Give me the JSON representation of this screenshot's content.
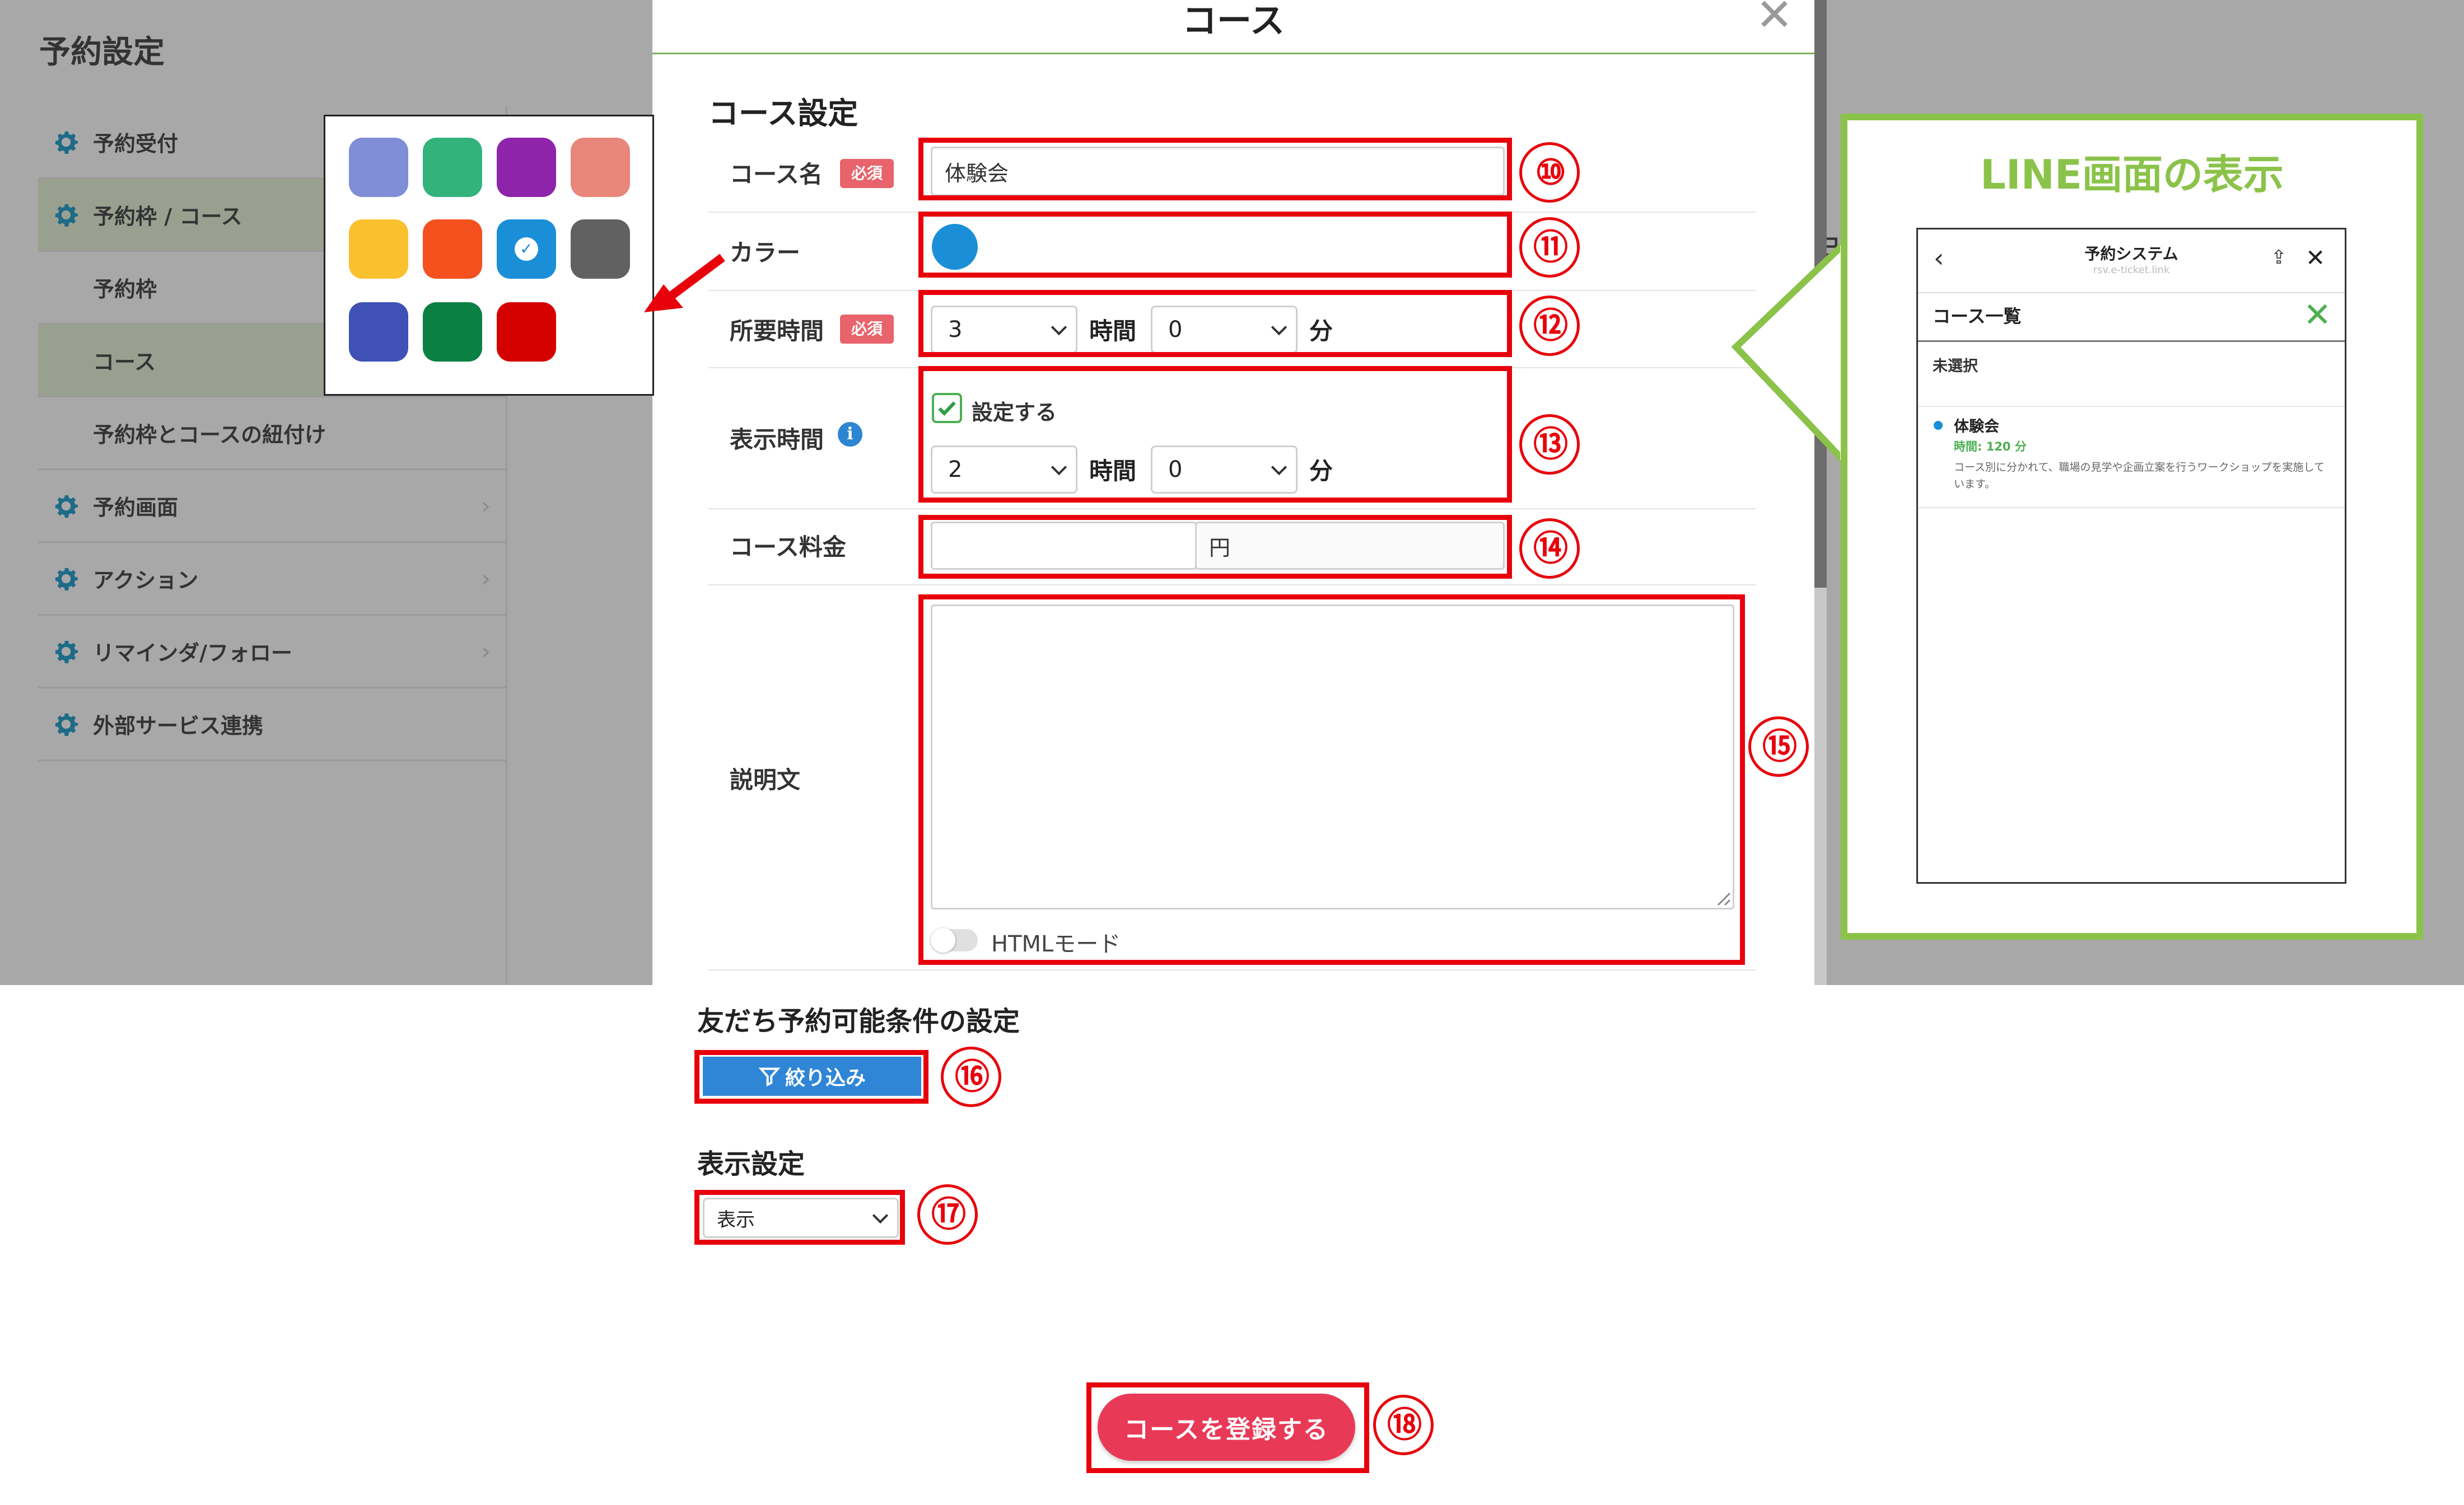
{
  "background_app": {
    "page_title": "予約設定",
    "sidebar": {
      "items": [
        {
          "label": "予約受付",
          "icon": "gear-icon"
        },
        {
          "label": "予約枠 / コース",
          "icon": "gear-icon"
        },
        {
          "label": "予約枠"
        },
        {
          "label": "コース"
        },
        {
          "label": "予約枠とコースの紐付け"
        },
        {
          "label": "予約画面",
          "icon": "gear-icon",
          "chevron": "›"
        },
        {
          "label": "アクション",
          "icon": "gear-icon",
          "chevron": "›"
        },
        {
          "label": "リマインダ/フォロー",
          "icon": "gear-icon",
          "chevron": "›"
        },
        {
          "label": "外部サービス連携",
          "icon": "gear-icon"
        }
      ]
    },
    "right_fragment": "日"
  },
  "modal": {
    "title": "コース",
    "close": "✕",
    "section_title": "コース設定",
    "course_name": {
      "label": "コース名",
      "required": "必須",
      "value": "体験会"
    },
    "color": {
      "label": "カラー",
      "selected": "#1a8fd8"
    },
    "duration": {
      "label": "所要時間",
      "required": "必須",
      "hours": "3",
      "hours_unit": "時間",
      "minutes": "0",
      "minutes_unit": "分"
    },
    "display_time": {
      "label": "表示時間",
      "info": "i",
      "checkbox_label": "設定する",
      "checked": true,
      "hours": "2",
      "hours_unit": "時間",
      "minutes": "0",
      "minutes_unit": "分"
    },
    "fee": {
      "label": "コース料金",
      "value": "",
      "unit": "円"
    },
    "description": {
      "label": "説明文",
      "value": "",
      "html_mode_label": "HTMLモード"
    }
  },
  "palette": {
    "colors": [
      "#7f8ed6",
      "#32b37c",
      "#8e24aa",
      "#e8867c",
      "#fbc02d",
      "#f4511e",
      "#1a8fd8",
      "#616161",
      "#3f51b5",
      "#0b8043",
      "#d50000"
    ],
    "selected_index": 6,
    "check": "✓"
  },
  "line_preview": {
    "title": "LINE画面の表示",
    "app_title": "予約システム",
    "url": "rsv.e-ticket.link",
    "back": "‹",
    "share": "⇪",
    "close": "✕",
    "list_title": "コース一覧",
    "list_close": "✕",
    "unselected": "未選択",
    "course_name": "体験会",
    "course_time": "時間: 120 分",
    "course_desc": "コース別に分かれて、職場の見学や企画立案を行うワークショップを実施しています。"
  },
  "lower": {
    "friends_condition_title": "友だち予約可能条件の設定",
    "filter_button": "絞り込み",
    "display_settings_title": "表示設定",
    "display_select_value": "表示",
    "register_button": "コースを登録する"
  },
  "annotations": [
    "⑩",
    "⑪",
    "⑫",
    "⑬",
    "⑭",
    "⑮",
    "⑯",
    "⑰",
    "⑱"
  ],
  "colors": {
    "annotation_red": "#e8000b",
    "line_green": "#8bc34a",
    "primary_blue": "#2f86d6",
    "register_pink": "#e83a57"
  }
}
